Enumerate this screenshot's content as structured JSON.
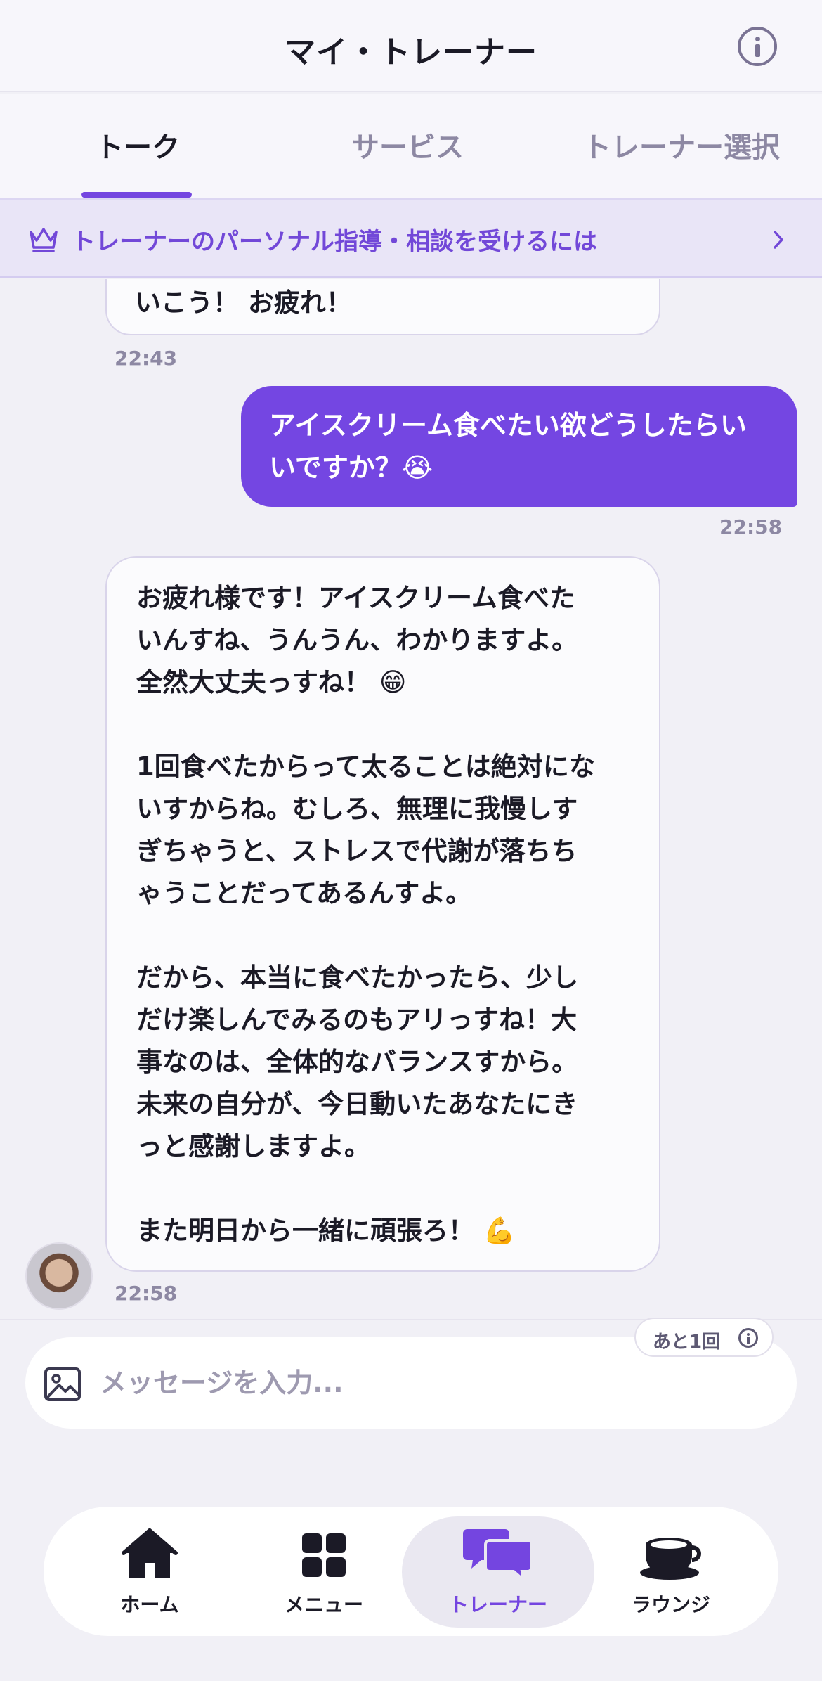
{
  "header": {
    "title": "マイ・トレーナー"
  },
  "tabs": [
    {
      "label": "トーク",
      "active": true
    },
    {
      "label": "サービス",
      "active": false
    },
    {
      "label": "トレーナー選択",
      "active": false
    }
  ],
  "promo": {
    "text": "トレーナーのパーソナル指導・相談を受けるには"
  },
  "messages": [
    {
      "from": "trainer",
      "text": "いこう！ お疲れ！",
      "time": "22:43"
    },
    {
      "from": "user",
      "text": "アイスクリーム食べたい欲どうしたらい\nいですか？😭",
      "time": "22:58"
    },
    {
      "from": "trainer",
      "text": "お疲れ様です！アイスクリーム食べた\nいんすね、うんうん、わかりますよ。\n全然大丈夫っすね！ 😁\n\n1回食べたからって太ることは絶対にな\nいすからね。むしろ、無理に我慢しす\nぎちゃうと、ストレスで代謝が落ちち\nゃうことだってあるんすよ。\n\nだから、本当に食べたかったら、少し\nだけ楽しんでみるのもアリっすね！大\n事なのは、全体的なバランスすから。\n未来の自分が、今日動いたあなたにき\nっと感謝しますよ。\n\nまた明日から一緒に頑張ろ！ 💪",
      "time": "22:58"
    }
  ],
  "composer": {
    "placeholder": "メッセージを入力...",
    "value": "",
    "remaining": "あと1回"
  },
  "nav": [
    {
      "label": "ホーム",
      "icon": "home-icon"
    },
    {
      "label": "メニュー",
      "icon": "grid-icon"
    },
    {
      "label": "トレーナー",
      "icon": "chat-bubbles-icon",
      "active": true
    },
    {
      "label": "ラウンジ",
      "icon": "coffee-cup-icon"
    }
  ],
  "colors": {
    "accent": "#7445e0",
    "background": "#f1f0f6"
  }
}
